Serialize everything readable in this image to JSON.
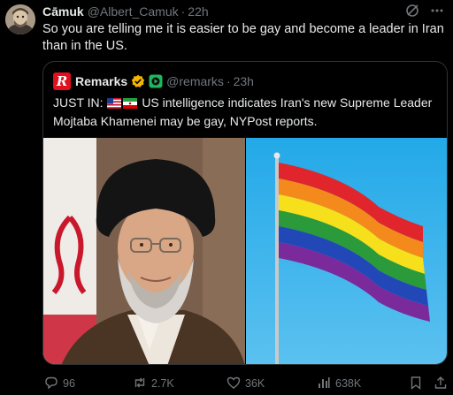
{
  "post": {
    "author_name": "Cāmuk",
    "author_handle": "@Albert_Camuk",
    "time": "22h",
    "text": "So you are telling me it is easier to be gay and become a leader in Iran than in the US."
  },
  "quote": {
    "author_name": "Remarks",
    "author_handle": "@remarks",
    "time": "23h",
    "logo_letter": "R",
    "text_prefix": "JUST IN:",
    "text_body": "US intelligence indicates Iran's new Supreme Leader Mojtaba Khamenei may be gay, NYPost reports."
  },
  "actions": {
    "replies": "96",
    "reposts": "2.7K",
    "likes": "36K",
    "views": "638K"
  },
  "icons": [
    "grok-icon",
    "more-icon",
    "verified-badge-icon",
    "affiliate-badge-icon",
    "reply-icon",
    "repost-icon",
    "like-icon",
    "views-icon",
    "bookmark-icon",
    "share-icon"
  ],
  "colors": {
    "background": "#000000",
    "text": "#e7e9ea",
    "muted": "#71767b",
    "border": "#2f3336",
    "gold_badge": "#f4b400",
    "green_badge": "#1eb85c",
    "logo_red": "#e0101e"
  }
}
